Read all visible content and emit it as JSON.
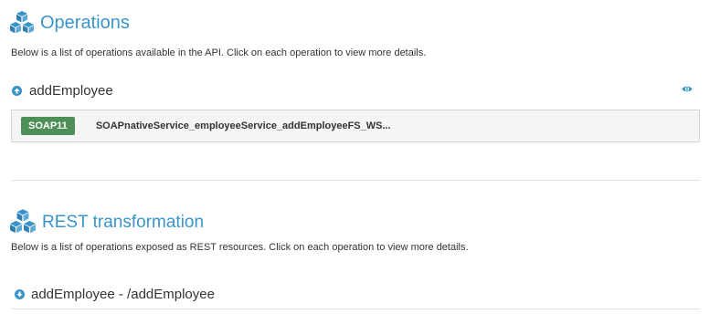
{
  "operations_section": {
    "title": "Operations",
    "description": "Below is a list of operations available in the API. Click on each operation to view more details.",
    "operation": {
      "name": "addEmployee",
      "toggle_icon": "arrow-up-circle-icon",
      "view_icon": "eye-icon"
    },
    "binding": {
      "badge": "SOAP11",
      "name": "SOAPnativeService_employeeService_addEmployeeFS_WS..."
    }
  },
  "rest_section": {
    "title": "REST transformation",
    "description": "Below is a list of operations exposed as REST resources. Click on each operation to view more details.",
    "operation": {
      "name": "addEmployee - /addEmployee",
      "toggle_icon": "arrow-down-circle-icon"
    }
  },
  "colors": {
    "accent": "#3a94c9",
    "badge": "#4e8e58",
    "binding_bg": "#f5f5f5"
  }
}
